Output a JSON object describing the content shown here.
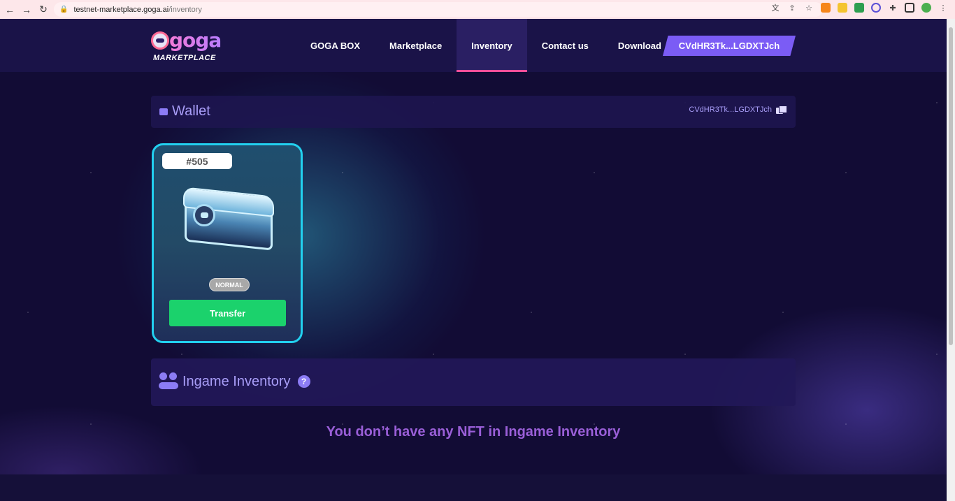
{
  "browser": {
    "url_host": "testnet-marketplace.goga.ai",
    "url_path": "/inventory"
  },
  "header": {
    "logo_top": "goga",
    "logo_bottom": "MARKETPLACE",
    "nav": [
      {
        "label": "GOGA BOX"
      },
      {
        "label": "Marketplace"
      },
      {
        "label": "Inventory"
      },
      {
        "label": "Contact us"
      },
      {
        "label": "Download"
      }
    ],
    "wallet_button": "CVdHR3Tk...LGDXTJch"
  },
  "wallet": {
    "title": "Wallet",
    "address": "CVdHR3Tk...LGDXTJch"
  },
  "nft_card": {
    "id": "#505",
    "rarity": "NORMAL",
    "transfer_label": "Transfer"
  },
  "ingame": {
    "title": "Ingame Inventory",
    "help": "?",
    "empty_message": "You don’t have any NFT in Ingame Inventory"
  },
  "colors": {
    "accent": "#7b5cf5",
    "active_underline": "#ff4f9a",
    "card_border": "#22d0ef",
    "transfer_green": "#1bd26c"
  }
}
